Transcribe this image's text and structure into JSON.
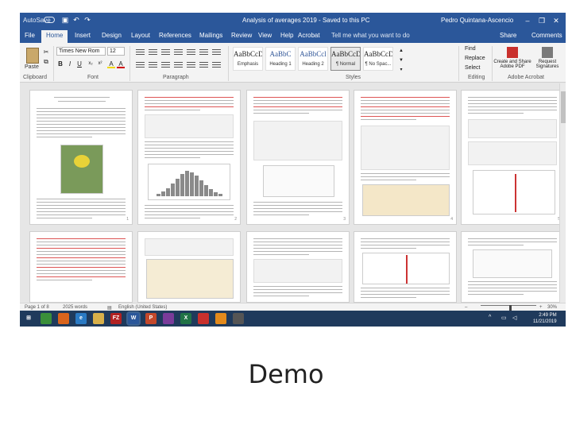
{
  "window": {
    "autosave_label": "AutoSave",
    "autosave_state": "off",
    "title": "Analysis of averages 2019 - Saved to this PC",
    "user": "Pedro Quintana-Ascencio"
  },
  "ribbon_tabs": [
    "File",
    "Home",
    "Insert",
    "Design",
    "Layout",
    "References",
    "Mailings",
    "Review",
    "View",
    "Help",
    "Acrobat"
  ],
  "active_tab": "Home",
  "tell_me": "Tell me what you want to do",
  "share_label": "Share",
  "comments_label": "Comments",
  "clipboard": {
    "paste_label": "Paste",
    "group_label": "Clipboard"
  },
  "font": {
    "name": "Times New Rom",
    "size": "12",
    "group_label": "Font",
    "buttons": [
      "B",
      "I",
      "U",
      "x₂",
      "x²",
      "A",
      "A"
    ]
  },
  "paragraph": {
    "group_label": "Paragraph"
  },
  "styles": {
    "group_label": "Styles",
    "items": [
      {
        "sample": "AaBbCcDc",
        "name": "Emphasis",
        "blue": false
      },
      {
        "sample": "AaBbC",
        "name": "Heading 1",
        "blue": true
      },
      {
        "sample": "AaBbCcl",
        "name": "Heading 2",
        "blue": true
      },
      {
        "sample": "AaBbCcDc",
        "name": "¶ Normal",
        "blue": false
      },
      {
        "sample": "AaBbCcDc",
        "name": "¶ No Spac...",
        "blue": false
      }
    ],
    "selected_index": 3
  },
  "editing": {
    "group_label": "Editing",
    "items": [
      "Find",
      "Replace",
      "Select"
    ]
  },
  "adobe": {
    "group_label": "Adobe Acrobat",
    "buttons": [
      "Create and Share Adobe PDF",
      "Request Signatures"
    ]
  },
  "status": {
    "page": "Page 1 of 8",
    "words": "2025 words",
    "language": "English (United States)",
    "zoom": "30%"
  },
  "taskbar": {
    "apps": [
      {
        "icon": "chrome-icon",
        "label": "",
        "color": "#3a8f3a"
      },
      {
        "icon": "firefox-icon",
        "label": "",
        "color": "#d9641c"
      },
      {
        "icon": "ie-icon",
        "label": "e",
        "color": "#2a7ac4"
      },
      {
        "icon": "folder-icon",
        "label": "",
        "color": "#d8b04a"
      },
      {
        "icon": "filezilla-icon",
        "label": "FZ",
        "color": "#b22222"
      },
      {
        "icon": "word-icon",
        "label": "W",
        "color": "#2b579a"
      },
      {
        "icon": "powerpoint-icon",
        "label": "P",
        "color": "#c4482b"
      },
      {
        "icon": "onenote-icon",
        "label": "",
        "color": "#7a3b9a"
      },
      {
        "icon": "excel-icon",
        "label": "X",
        "color": "#217346"
      },
      {
        "icon": "acrobat-icon",
        "label": "",
        "color": "#c9302c"
      },
      {
        "icon": "vlc-icon",
        "label": "",
        "color": "#e38a1c"
      },
      {
        "icon": "camera-icon",
        "label": "",
        "color": "#555555"
      }
    ],
    "active_index": 5,
    "time": "2:49 PM",
    "date": "11/21/2019"
  },
  "caption": "Demo"
}
